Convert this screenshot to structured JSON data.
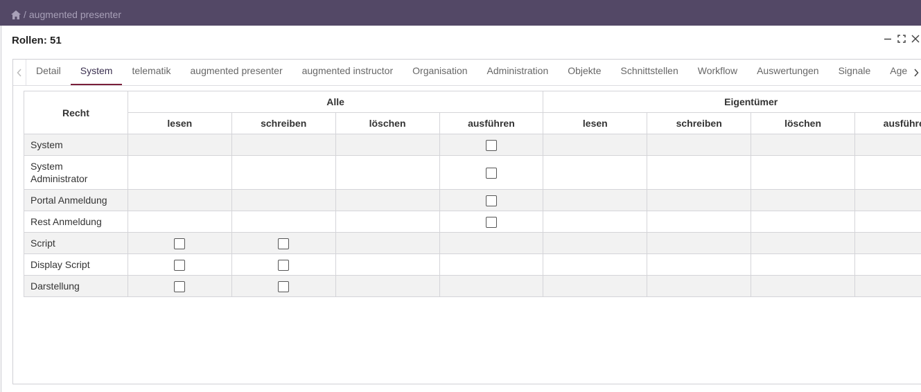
{
  "breadcrumb": {
    "separator": "/",
    "current": "augmented presenter"
  },
  "dialog": {
    "title": "Rollen: 51"
  },
  "tabs": [
    {
      "label": "Detail",
      "active": false
    },
    {
      "label": "System",
      "active": true
    },
    {
      "label": "telematik",
      "active": false
    },
    {
      "label": "augmented presenter",
      "active": false
    },
    {
      "label": "augmented instructor",
      "active": false
    },
    {
      "label": "Organisation",
      "active": false
    },
    {
      "label": "Administration",
      "active": false
    },
    {
      "label": "Objekte",
      "active": false
    },
    {
      "label": "Schnittstellen",
      "active": false
    },
    {
      "label": "Workflow",
      "active": false
    },
    {
      "label": "Auswertungen",
      "active": false
    },
    {
      "label": "Signale",
      "active": false
    },
    {
      "label": "Age",
      "active": false
    }
  ],
  "table": {
    "recht_header": "Recht",
    "groups": [
      "Alle",
      "Eigentümer"
    ],
    "columns": [
      "lesen",
      "schreiben",
      "löschen",
      "ausführen",
      "lesen",
      "schreiben",
      "löschen",
      "ausführen"
    ],
    "rows": [
      {
        "name": "System",
        "checkboxes": [
          false,
          false,
          false,
          true,
          false,
          false,
          false,
          false
        ]
      },
      {
        "name": "System Administrator",
        "checkboxes": [
          false,
          false,
          false,
          true,
          false,
          false,
          false,
          false
        ]
      },
      {
        "name": "Portal Anmeldung",
        "checkboxes": [
          false,
          false,
          false,
          true,
          false,
          false,
          false,
          false
        ]
      },
      {
        "name": "Rest Anmeldung",
        "checkboxes": [
          false,
          false,
          false,
          true,
          false,
          false,
          false,
          false
        ]
      },
      {
        "name": "Script",
        "checkboxes": [
          true,
          true,
          false,
          false,
          false,
          false,
          false,
          false
        ]
      },
      {
        "name": "Display Script",
        "checkboxes": [
          true,
          true,
          false,
          false,
          false,
          false,
          false,
          false
        ]
      },
      {
        "name": "Darstellung",
        "checkboxes": [
          true,
          true,
          false,
          false,
          false,
          false,
          false,
          false
        ]
      }
    ]
  },
  "colors": {
    "topbar": "#534866",
    "active_tab_underline": "#7a1e3a"
  },
  "icons": [
    "home-icon",
    "minimize-icon",
    "maximize-icon",
    "close-icon",
    "chevron-left-icon",
    "chevron-right-icon",
    "checkbox-icon"
  ]
}
